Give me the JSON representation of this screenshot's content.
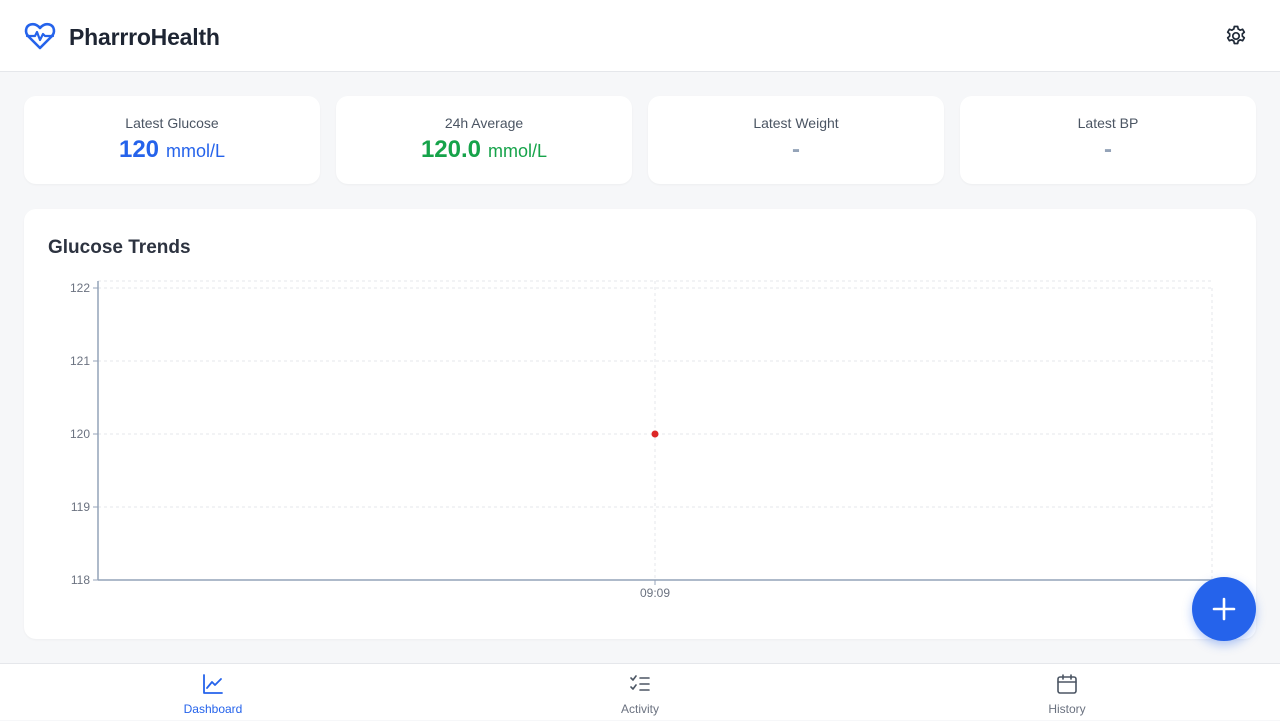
{
  "app": {
    "title": "PharrroHealth"
  },
  "stats": {
    "glucose": {
      "label": "Latest Glucose",
      "value": "120",
      "unit": "mmol/L"
    },
    "average": {
      "label": "24h Average",
      "value": "120.0",
      "unit": "mmol/L"
    },
    "weight": {
      "label": "Latest Weight",
      "value": "-"
    },
    "bp": {
      "label": "Latest BP",
      "value": "-"
    }
  },
  "chart_card": {
    "title": "Glucose Trends"
  },
  "chart_data": {
    "type": "scatter",
    "title": "Glucose Trends",
    "xlabel": "",
    "ylabel": "",
    "x": [
      "09:09"
    ],
    "y": [
      120
    ],
    "ylim": [
      118,
      122
    ],
    "yticks": [
      118,
      119,
      120,
      121,
      122
    ],
    "grid": true,
    "point_color": "#dc2626"
  },
  "nav": {
    "items": [
      {
        "label": "Dashboard",
        "icon": "chart-line-icon",
        "active": true
      },
      {
        "label": "Activity",
        "icon": "checklist-icon",
        "active": false
      },
      {
        "label": "History",
        "icon": "calendar-icon",
        "active": false
      }
    ]
  },
  "fab": {
    "icon": "plus-icon"
  },
  "colors": {
    "accent": "#2563eb",
    "success": "#16a34a",
    "point": "#dc2626"
  }
}
